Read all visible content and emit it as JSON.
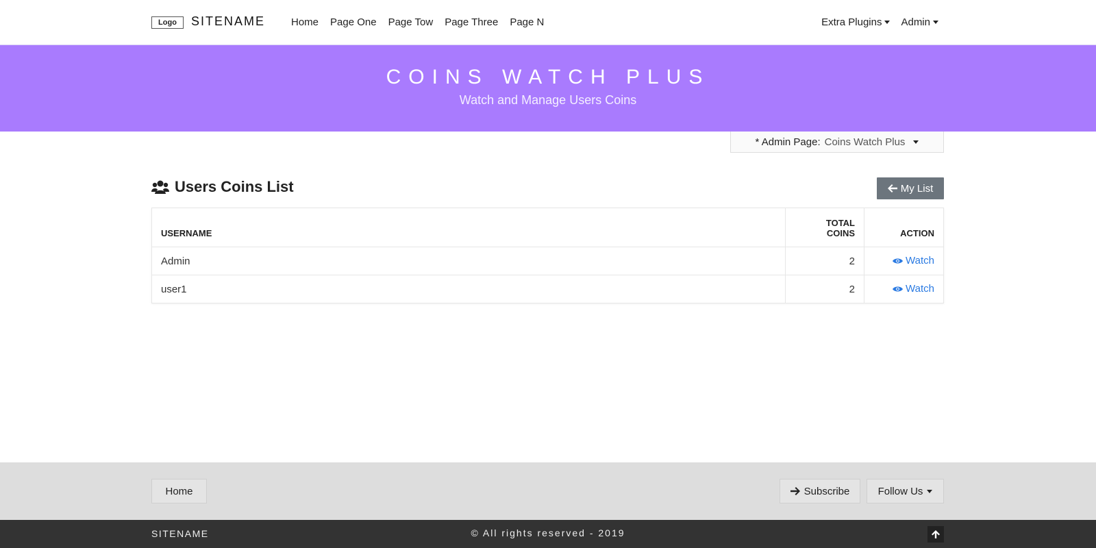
{
  "navbar": {
    "logo_text": "Logo",
    "sitename": "SITENAME",
    "links": [
      "Home",
      "Page One",
      "Page Tow",
      "Page Three",
      "Page N"
    ],
    "extra_plugins": "Extra Plugins",
    "admin": "Admin"
  },
  "hero": {
    "title": "COINS WATCH PLUS",
    "subtitle": "Watch and Manage Users Coins",
    "background": "#a97bfe"
  },
  "admin_page": {
    "label": "* Admin Page:",
    "value": "Coins Watch Plus"
  },
  "section": {
    "title": "Users Coins List",
    "icon": "users-icon",
    "my_list_label": "My List"
  },
  "table": {
    "headers": {
      "username": "USERNAME",
      "total_coins_line1": "TOTAL",
      "total_coins_line2": "COINS",
      "action": "ACTION"
    },
    "rows": [
      {
        "username": "Admin",
        "total_coins": "2",
        "action": "Watch"
      },
      {
        "username": "user1",
        "total_coins": "2",
        "action": "Watch"
      }
    ],
    "link_color": "#2a7ae2"
  },
  "footer": {
    "home": "Home",
    "subscribe": "Subscribe",
    "follow_us": "Follow Us",
    "sitename": "SITENAME",
    "copyright": "© All rights reserved - 2019"
  }
}
